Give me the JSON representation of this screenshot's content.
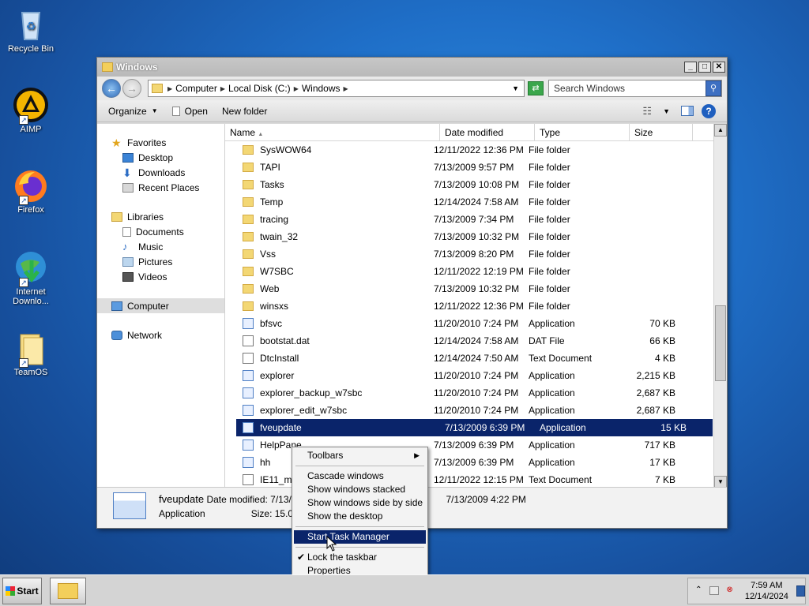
{
  "desktop": {
    "icons": [
      {
        "label": "Recycle Bin"
      },
      {
        "label": "AIMP"
      },
      {
        "label": "Firefox"
      },
      {
        "label": "Internet Downlo..."
      },
      {
        "label": "TeamOS"
      }
    ]
  },
  "window": {
    "title": "Windows",
    "address": [
      "Computer",
      "Local Disk (C:)",
      "Windows"
    ],
    "search_placeholder": "Search Windows",
    "toolbar": {
      "organize": "Organize",
      "open": "Open",
      "new_folder": "New folder"
    },
    "nav": {
      "favorites": "Favorites",
      "fav_items": [
        "Desktop",
        "Downloads",
        "Recent Places"
      ],
      "libraries": "Libraries",
      "lib_items": [
        "Documents",
        "Music",
        "Pictures",
        "Videos"
      ],
      "computer": "Computer",
      "network": "Network"
    },
    "columns": [
      "Name",
      "Date modified",
      "Type",
      "Size"
    ],
    "files": [
      {
        "name": "SysWOW64",
        "date": "12/11/2022 12:36 PM",
        "type": "File folder",
        "size": "",
        "kind": "folder"
      },
      {
        "name": "TAPI",
        "date": "7/13/2009 9:57 PM",
        "type": "File folder",
        "size": "",
        "kind": "folder"
      },
      {
        "name": "Tasks",
        "date": "7/13/2009 10:08 PM",
        "type": "File folder",
        "size": "",
        "kind": "folder"
      },
      {
        "name": "Temp",
        "date": "12/14/2024 7:58 AM",
        "type": "File folder",
        "size": "",
        "kind": "folder"
      },
      {
        "name": "tracing",
        "date": "7/13/2009 7:34 PM",
        "type": "File folder",
        "size": "",
        "kind": "folder"
      },
      {
        "name": "twain_32",
        "date": "7/13/2009 10:32 PM",
        "type": "File folder",
        "size": "",
        "kind": "folder"
      },
      {
        "name": "Vss",
        "date": "7/13/2009 8:20 PM",
        "type": "File folder",
        "size": "",
        "kind": "folder"
      },
      {
        "name": "W7SBC",
        "date": "12/11/2022 12:19 PM",
        "type": "File folder",
        "size": "",
        "kind": "folder"
      },
      {
        "name": "Web",
        "date": "7/13/2009 10:32 PM",
        "type": "File folder",
        "size": "",
        "kind": "folder"
      },
      {
        "name": "winsxs",
        "date": "12/11/2022 12:36 PM",
        "type": "File folder",
        "size": "",
        "kind": "folder"
      },
      {
        "name": "bfsvc",
        "date": "11/20/2010 7:24 PM",
        "type": "Application",
        "size": "70 KB",
        "kind": "app"
      },
      {
        "name": "bootstat.dat",
        "date": "12/14/2024 7:58 AM",
        "type": "DAT File",
        "size": "66 KB",
        "kind": "doc"
      },
      {
        "name": "DtcInstall",
        "date": "12/14/2024 7:50 AM",
        "type": "Text Document",
        "size": "4 KB",
        "kind": "doc"
      },
      {
        "name": "explorer",
        "date": "11/20/2010 7:24 PM",
        "type": "Application",
        "size": "2,215 KB",
        "kind": "app"
      },
      {
        "name": "explorer_backup_w7sbc",
        "date": "11/20/2010 7:24 PM",
        "type": "Application",
        "size": "2,687 KB",
        "kind": "app"
      },
      {
        "name": "explorer_edit_w7sbc",
        "date": "11/20/2010 7:24 PM",
        "type": "Application",
        "size": "2,687 KB",
        "kind": "app"
      },
      {
        "name": "fveupdate",
        "date": "7/13/2009 6:39 PM",
        "type": "Application",
        "size": "15 KB",
        "kind": "app"
      },
      {
        "name": "HelpPane",
        "date": "7/13/2009 6:39 PM",
        "type": "Application",
        "size": "717 KB",
        "kind": "app"
      },
      {
        "name": "hh",
        "date": "7/13/2009 6:39 PM",
        "type": "Application",
        "size": "17 KB",
        "kind": "app"
      },
      {
        "name": "IE11_main",
        "date": "12/11/2022 12:15 PM",
        "type": "Text Document",
        "size": "7 KB",
        "kind": "doc"
      }
    ],
    "details": {
      "name": "fveupdate",
      "type": "Application",
      "modified_label": "Date modified: 7/13/",
      "size_label": "Size: 15.0 K",
      "created": "7/13/2009 4:22 PM"
    }
  },
  "context_menu": {
    "toolbars": "Toolbars",
    "cascade": "Cascade windows",
    "stacked": "Show windows stacked",
    "side": "Show windows side by side",
    "desktop": "Show the desktop",
    "task_manager": "Start Task Manager",
    "lock": "Lock the taskbar",
    "properties": "Properties"
  },
  "taskbar": {
    "start": "Start",
    "time": "7:59 AM",
    "date": "12/14/2024"
  }
}
